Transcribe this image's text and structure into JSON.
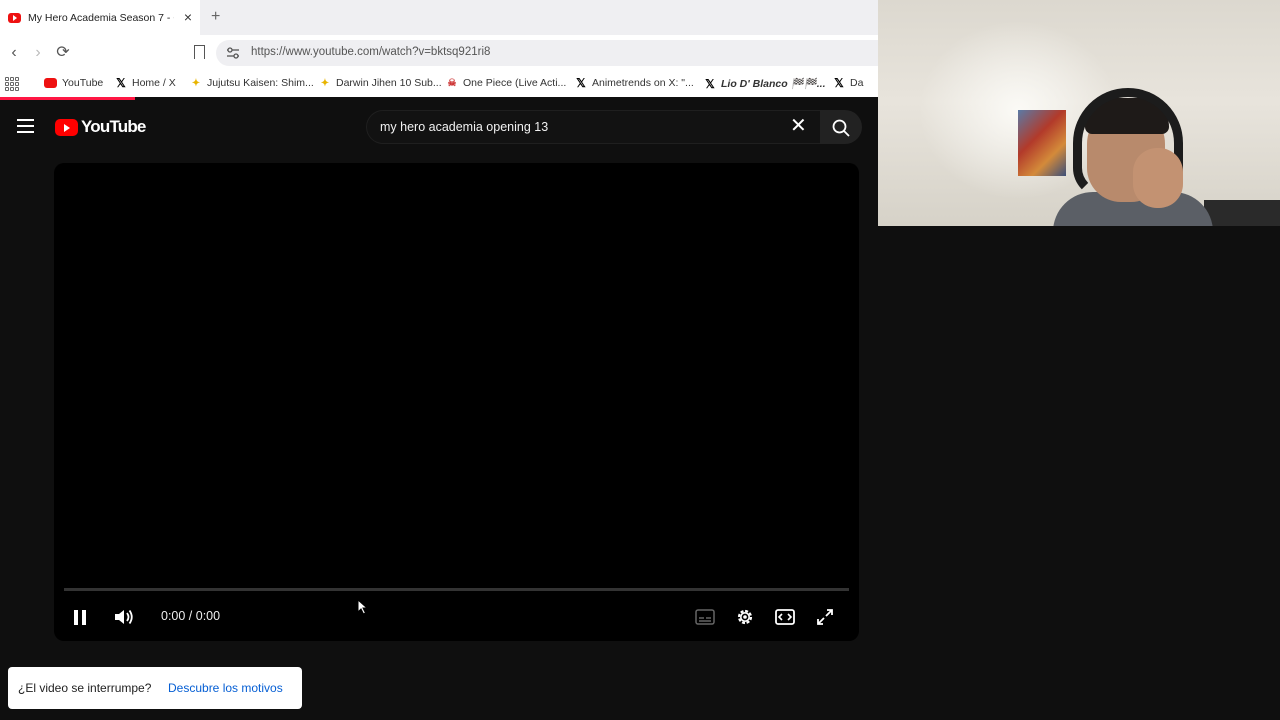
{
  "browser": {
    "tab": {
      "title": "My Hero Academia Season 7 - O"
    },
    "url": "https://www.youtube.com/watch?v=bktsq921ri8",
    "bookmarks": [
      {
        "label": "YouTube",
        "icon": "youtube-icon"
      },
      {
        "label": "Home / X",
        "icon": "x-icon"
      },
      {
        "label": "Jujutsu Kaisen: Shim...",
        "icon": "star-icon"
      },
      {
        "label": "Darwin Jihen 10 Sub...",
        "icon": "star-icon"
      },
      {
        "label": "One Piece (Live Acti...",
        "icon": "onepiece-icon"
      },
      {
        "label": "Animetrends on X: \"...",
        "icon": "x-icon"
      },
      {
        "label": "Lio D' Blanco 🏁🏁...",
        "icon": "x-icon"
      },
      {
        "label": "Da",
        "icon": "x-icon"
      }
    ]
  },
  "youtube": {
    "logo_text": "YouTube",
    "search_value": "my hero academia opening 13",
    "player": {
      "time": "0:00 / 0:00",
      "progress": 0
    },
    "popup": {
      "question": "¿El video se interrumpe?",
      "link": "Descubre los motivos"
    }
  },
  "colors": {
    "accent": "#ff0000",
    "link": "#065fd4",
    "background": "#0f0f0f"
  }
}
